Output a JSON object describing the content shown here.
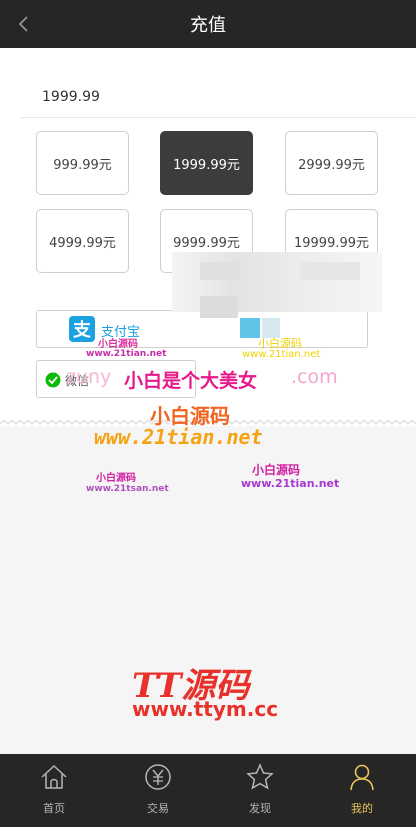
{
  "header": {
    "title": "充值"
  },
  "amount": {
    "value": "1999.99"
  },
  "options": [
    {
      "label": "999.99元",
      "selected": false
    },
    {
      "label": "1999.99元",
      "selected": true
    },
    {
      "label": "2999.99元",
      "selected": false
    },
    {
      "label": "4999.99元",
      "selected": false
    },
    {
      "label": "9999.99元",
      "selected": false
    },
    {
      "label": "19999.99元",
      "selected": false
    }
  ],
  "payment": {
    "alipay_label": "支付宝",
    "wechat_label": "微信"
  },
  "watermarks": {
    "brand_small": "小白源码",
    "site": "www.21tian.net",
    "site_faded": "www.21tsan.net",
    "slogan": "小白是个大美女",
    "partial_left": "zuny",
    "partial_right": ".com",
    "brand_mid": "小白源码",
    "tt_brand": "TT源码",
    "tt_site": "www.ttym.cc"
  },
  "tabbar": {
    "items": [
      {
        "label": "首页",
        "icon": "home-icon",
        "active": false
      },
      {
        "label": "交易",
        "icon": "yuan-icon",
        "active": false
      },
      {
        "label": "发现",
        "icon": "star-icon",
        "active": false
      },
      {
        "label": "我的",
        "icon": "user-icon",
        "active": true
      }
    ]
  },
  "colors": {
    "header_bg": "#262626",
    "active_option": "#3c3c3c",
    "tab_active": "#e9c35b",
    "alipay": "#1ba1e2",
    "wechat": "#09bb07"
  }
}
